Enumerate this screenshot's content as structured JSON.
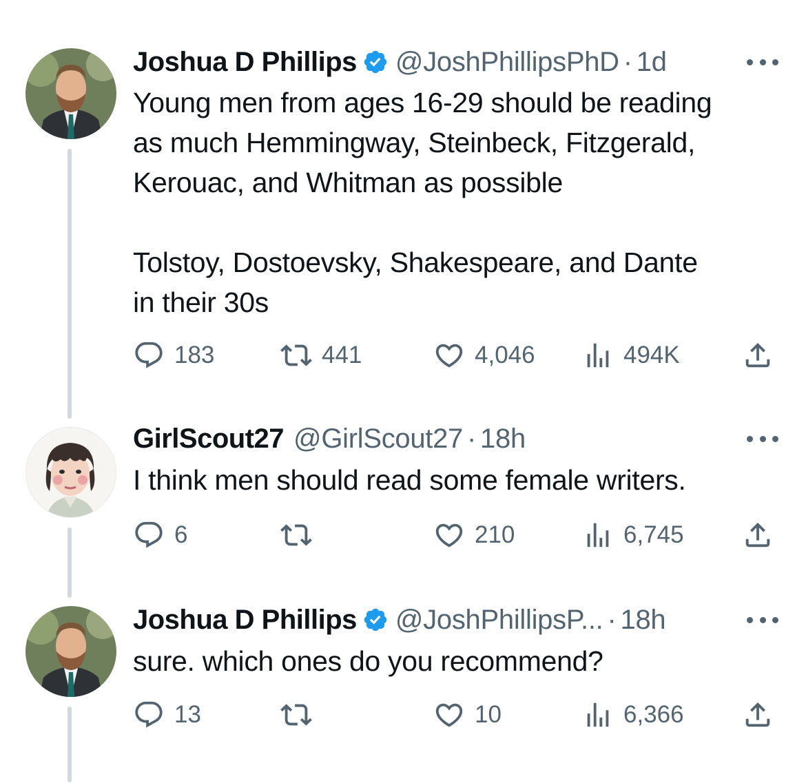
{
  "tweets": [
    {
      "name": "Joshua D Phillips",
      "handle": "@JoshPhillipsPhD",
      "dot": "·",
      "time": "1d",
      "lines": [
        "Young men from ages 16-29 should be reading",
        "as much Hemmingway, Steinbeck, Fitzgerald,",
        "Kerouac, and Whitman as possible",
        "Tolstoy, Dostoevsky, Shakespeare, and Dante",
        "in their 30s"
      ],
      "replies": "183",
      "retweets": "441",
      "likes": "4,046",
      "views": "494K"
    },
    {
      "name": "GirlScout27",
      "handle": "@GirlScout27",
      "dot": "·",
      "time": "18h",
      "lines": [
        "I think men should read some female writers."
      ],
      "replies": "6",
      "retweets": "",
      "likes": "210",
      "views": "6,745"
    },
    {
      "name": "Joshua D Phillips",
      "handle": "@JoshPhillipsP...",
      "dot": "·",
      "time": "18h",
      "lines": [
        "sure. which ones do you recommend?"
      ],
      "replies": "13",
      "retweets": "",
      "likes": "10",
      "views": "6,366"
    }
  ],
  "icons": {
    "reply": "reply-icon",
    "retweet": "retweet-icon",
    "like": "heart-icon",
    "views": "views-icon",
    "share": "share-icon",
    "verified": "verified-badge-icon",
    "more": "more-icon"
  },
  "colors": {
    "verified": "#1d9bf0",
    "secondary_text": "#536471",
    "thread_line": "#cfd9de"
  }
}
